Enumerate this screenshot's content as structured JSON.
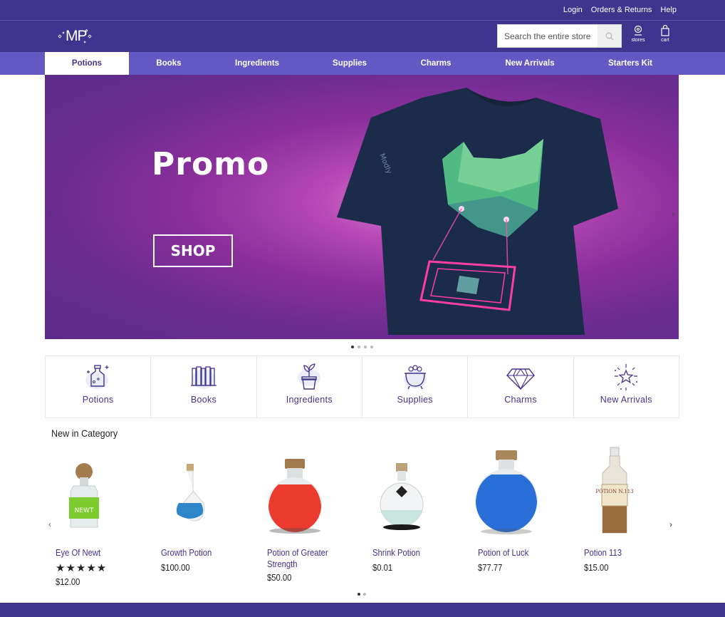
{
  "toplinks": {
    "login": "Login",
    "orders": "Orders & Returns",
    "help": "Help"
  },
  "logo": {
    "text": "MP"
  },
  "search": {
    "placeholder": "Search the entire store"
  },
  "header_icons": {
    "stores": "stores",
    "cart": "cart"
  },
  "nav": {
    "items": [
      {
        "label": "Potions"
      },
      {
        "label": "Books"
      },
      {
        "label": "Ingredients"
      },
      {
        "label": "Supplies"
      },
      {
        "label": "Charms"
      },
      {
        "label": "New Arrivals"
      },
      {
        "label": "Starters Kit"
      }
    ],
    "active_index": 0
  },
  "hero": {
    "title": "Promo",
    "button": "SHOP",
    "shirt_brand": "Modly",
    "slide_count": 4,
    "active_slide": 0
  },
  "categories": [
    {
      "label": "Potions",
      "icon": "potion-bottle-icon"
    },
    {
      "label": "Books",
      "icon": "books-icon"
    },
    {
      "label": "Ingredients",
      "icon": "plant-pot-icon"
    },
    {
      "label": "Supplies",
      "icon": "cauldron-icon"
    },
    {
      "label": "Charms",
      "icon": "diamond-icon"
    },
    {
      "label": "New Arrivals",
      "icon": "sparkle-burst-icon"
    }
  ],
  "section": {
    "title": "New in Category"
  },
  "products": [
    {
      "name": "Eye Of Newt",
      "price": "$12.00",
      "rating": "★★★★★",
      "label": "NEWT"
    },
    {
      "name": "Growth Potion",
      "price": "$100.00"
    },
    {
      "name": "Potion of Greater Strength",
      "price": "$50.00"
    },
    {
      "name": "Shrink Potion",
      "price": "$0.01"
    },
    {
      "name": "Potion of Luck",
      "price": "$77.77"
    },
    {
      "name": "Potion 113",
      "price": "$15.00",
      "label": "POTION N.113"
    }
  ],
  "colors": {
    "brand": "#3f358f",
    "nav": "#6358c4"
  }
}
